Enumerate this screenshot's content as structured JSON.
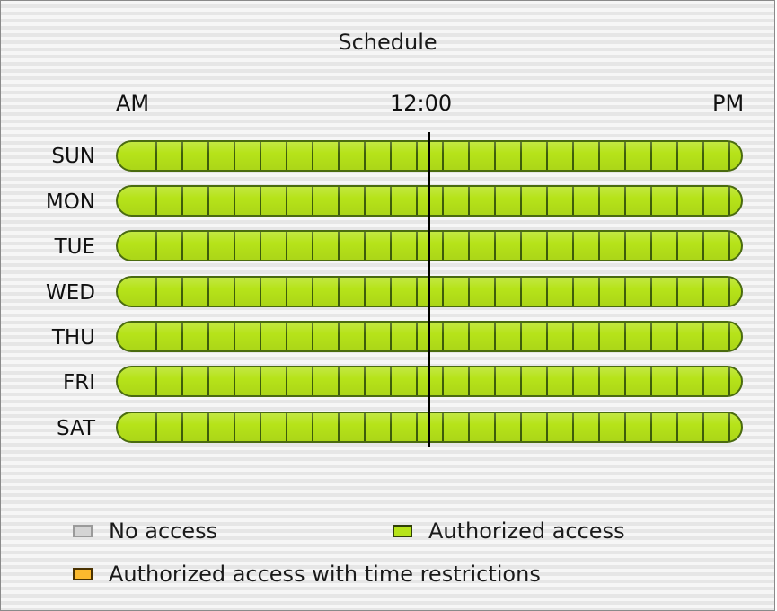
{
  "schedule": {
    "title": "Schedule",
    "axis": {
      "start_label": "AM",
      "mid_label": "12:00",
      "end_label": "PM"
    },
    "days": [
      {
        "label": "SUN",
        "state": "Authorized access"
      },
      {
        "label": "MON",
        "state": "Authorized access"
      },
      {
        "label": "TUE",
        "state": "Authorized access"
      },
      {
        "label": "WED",
        "state": "Authorized access"
      },
      {
        "label": "THU",
        "state": "Authorized access"
      },
      {
        "label": "FRI",
        "state": "Authorized access"
      },
      {
        "label": "SAT",
        "state": "Authorized access"
      }
    ]
  },
  "legend": {
    "items": [
      {
        "label": "No access",
        "color": "#d4d4d4",
        "border": "#9a9a9a"
      },
      {
        "label": "Authorized access",
        "color": "#b6e319",
        "border": "#2f3f08"
      },
      {
        "label": "Authorized access with time restrictions",
        "color": "#fbb92e",
        "border": "#4a3200"
      }
    ]
  },
  "colors": {
    "authorized": "#b6e319",
    "bar_border": "#4a6b10",
    "noon_line": "#000000"
  }
}
